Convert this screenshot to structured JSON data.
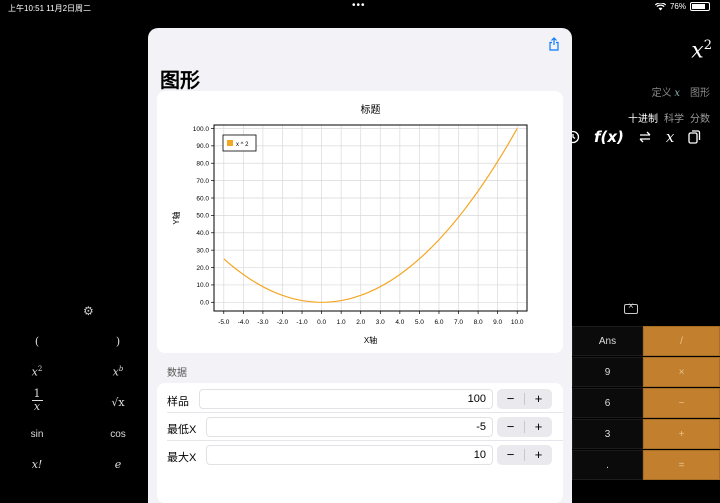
{
  "status": {
    "time": "上午10:51",
    "date": "11月2日周二",
    "battery": "76%"
  },
  "background": {
    "expression": {
      "base": "x",
      "exp": "2"
    },
    "tabs1": [
      "定义",
      "x",
      "图形"
    ],
    "tabs2": [
      "十进制",
      "科学",
      "分数"
    ],
    "icons": [
      "history-icon",
      "function-icon",
      "swap-icon",
      "variable-icon",
      "copy-icon"
    ],
    "fx_label": "f(x)",
    "x_label": "x"
  },
  "left_keys": {
    "paren_open": "(",
    "paren_close": ")",
    "x2_base": "x",
    "x2_exp": "2",
    "xb_base": "x",
    "xb_exp": "b",
    "frac_num": "1",
    "frac_den": "x",
    "sqrt": "√x",
    "sin": "sin",
    "cos": "cos",
    "fact": "x!",
    "e": "e"
  },
  "right_keys": [
    {
      "label": "Ans",
      "op": false
    },
    {
      "label": "/",
      "op": true
    },
    {
      "label": "9",
      "op": false
    },
    {
      "label": "×",
      "op": true
    },
    {
      "label": "6",
      "op": false
    },
    {
      "label": "−",
      "op": true
    },
    {
      "label": "3",
      "op": false
    },
    {
      "label": "+",
      "op": true
    },
    {
      "label": ".",
      "op": false
    },
    {
      "label": "=",
      "op": true
    }
  ],
  "modal": {
    "title": "图形",
    "section_label": "数据",
    "rows": [
      {
        "label": "样品",
        "value": "100"
      },
      {
        "label": "最低X",
        "value": "-5"
      },
      {
        "label": "最大X",
        "value": "10"
      }
    ],
    "minus": "−",
    "plus": "+"
  },
  "chart_data": {
    "type": "line",
    "title": "标题",
    "xlabel": "X轴",
    "ylabel": "Y轴",
    "xlim": [
      -5.5,
      10.5
    ],
    "ylim": [
      -5,
      102
    ],
    "x_ticks": [
      "-5.0",
      "-4.0",
      "-3.0",
      "-2.0",
      "-1.0",
      "0.0",
      "1.0",
      "2.0",
      "3.0",
      "4.0",
      "5.0",
      "6.0",
      "7.0",
      "8.0",
      "9.0",
      "10.0"
    ],
    "y_ticks": [
      "0.0",
      "10.0",
      "20.0",
      "30.0",
      "40.0",
      "50.0",
      "60.0",
      "70.0",
      "80.0",
      "90.0",
      "100.0"
    ],
    "grid": true,
    "legend_position": "top-left",
    "series": [
      {
        "name": "x ^ 2",
        "color": "#f5a623",
        "x": [
          -5,
          -4,
          -3,
          -2,
          -1,
          0,
          1,
          2,
          3,
          4,
          5,
          6,
          7,
          8,
          9,
          10
        ],
        "y": [
          25,
          16,
          9,
          4,
          1,
          0,
          1,
          4,
          9,
          16,
          25,
          36,
          49,
          64,
          81,
          100
        ]
      }
    ]
  }
}
